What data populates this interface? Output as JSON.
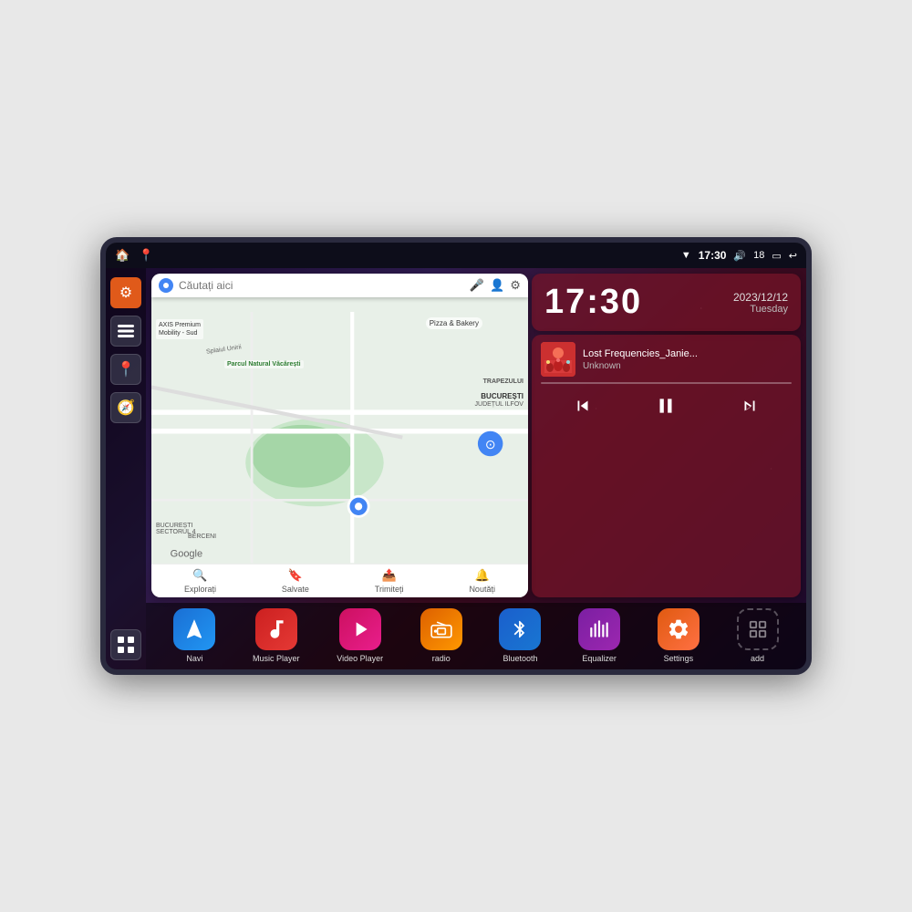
{
  "device": {
    "statusBar": {
      "leftIcons": [
        "🏠",
        "📍"
      ],
      "wifi": "▼",
      "time": "17:30",
      "volume": "🔊",
      "battery": "18",
      "batteryIcon": "🔋",
      "back": "↩"
    },
    "clock": {
      "time": "17:30",
      "date": "2023/12/12",
      "day": "Tuesday"
    },
    "music": {
      "title": "Lost Frequencies_Janie...",
      "artist": "Unknown",
      "albumEmoji": "🎵"
    },
    "map": {
      "searchPlaceholder": "Căutați aici",
      "locations": [
        "AXIS Premium Mobility - Sud",
        "Parcul Natural Văcărești",
        "Pizza & Bakery",
        "BUCUREȘTI SECTORUL 4",
        "BUCUREȘTI",
        "JUDEȚUL ILFOV",
        "BERCENI"
      ],
      "bottomItems": [
        {
          "label": "Explorați",
          "icon": "🔍"
        },
        {
          "label": "Salvate",
          "icon": "🔖"
        },
        {
          "label": "Trimiteți",
          "icon": "📤"
        },
        {
          "label": "Noutăți",
          "icon": "🔔"
        }
      ]
    },
    "sidebar": {
      "buttons": [
        "⚙",
        "📁",
        "📍",
        "🧭",
        "⋯"
      ]
    },
    "apps": [
      {
        "id": "navi",
        "label": "Navi",
        "icon": "🧭",
        "colorClass": "blue"
      },
      {
        "id": "music-player",
        "label": "Music Player",
        "icon": "🎵",
        "colorClass": "red"
      },
      {
        "id": "video-player",
        "label": "Video Player",
        "icon": "▶",
        "colorClass": "pink"
      },
      {
        "id": "radio",
        "label": "radio",
        "icon": "📻",
        "colorClass": "orange"
      },
      {
        "id": "bluetooth",
        "label": "Bluetooth",
        "icon": "⚡",
        "colorClass": "bluetooth"
      },
      {
        "id": "equalizer",
        "label": "Equalizer",
        "icon": "📊",
        "colorClass": "purple"
      },
      {
        "id": "settings",
        "label": "Settings",
        "icon": "⚙",
        "colorClass": "settings-orange"
      },
      {
        "id": "add",
        "label": "add",
        "icon": "+",
        "colorClass": "add"
      }
    ]
  }
}
